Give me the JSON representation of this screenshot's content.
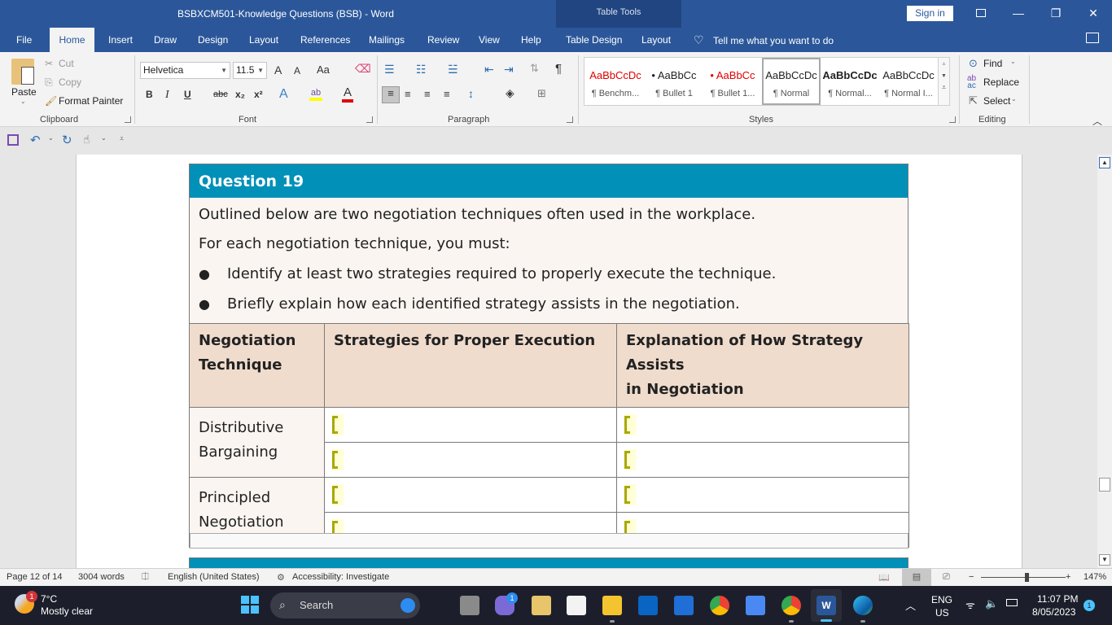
{
  "window": {
    "title": "BSBXCM501-Knowledge Questions (BSB)  -  Word",
    "context_tab_group": "Table Tools",
    "sign_in": "Sign in",
    "controls": [
      "ribbon-display-options",
      "minimize",
      "restore",
      "close"
    ]
  },
  "ribbon": {
    "tabs": [
      {
        "label": "File",
        "active": false
      },
      {
        "label": "Home",
        "active": true
      },
      {
        "label": "Insert",
        "active": false
      },
      {
        "label": "Draw",
        "active": false
      },
      {
        "label": "Design",
        "active": false
      },
      {
        "label": "Layout",
        "active": false
      },
      {
        "label": "References",
        "active": false
      },
      {
        "label": "Mailings",
        "active": false
      },
      {
        "label": "Review",
        "active": false
      },
      {
        "label": "View",
        "active": false
      },
      {
        "label": "Help",
        "active": false
      },
      {
        "label": "Table Design",
        "active": false
      },
      {
        "label": "Layout",
        "active": false
      }
    ],
    "tell_me": "Tell me what you want to do",
    "clipboard": {
      "label": "Clipboard",
      "paste": "Paste",
      "cut": "Cut",
      "copy": "Copy",
      "format_painter": "Format Painter"
    },
    "font": {
      "label": "Font",
      "font_name": "Helvetica",
      "font_size": "11.5",
      "grow": "A",
      "shrink": "A",
      "change_case": "Aa",
      "bold": "B",
      "italic": "I",
      "underline": "U",
      "strikethrough": "abc",
      "subscript": "x₂",
      "superscript": "x²",
      "highlight_color": "#ffff00",
      "font_color": "#e00000"
    },
    "paragraph": {
      "label": "Paragraph",
      "show_marks": "¶"
    },
    "styles": {
      "label": "Styles",
      "items": [
        {
          "sample": "AaBbCcDc",
          "name": "¶ Benchm...",
          "color": "#e00000",
          "selected": false
        },
        {
          "sample": "• AaBbCc",
          "name": "¶ Bullet 1",
          "color": "#222222",
          "selected": false
        },
        {
          "sample": "• AaBbCc",
          "name": "¶ Bullet 1...",
          "color": "#e00000",
          "selected": false
        },
        {
          "sample": "AaBbCcDc",
          "name": "¶ Normal",
          "color": "#222222",
          "selected": true
        },
        {
          "sample": "AaBbCcDc",
          "name": "¶ Normal...",
          "color": "#222222",
          "selected": false,
          "bold": true
        },
        {
          "sample": "AaBbCcDc",
          "name": "¶ Normal I...",
          "color": "#222222",
          "selected": false
        }
      ]
    },
    "editing": {
      "label": "Editing",
      "find": "Find",
      "replace": "Replace",
      "select": "Select"
    }
  },
  "document": {
    "question_title": "Question 19",
    "intro": "Outlined below are two negotiation techniques often used in the workplace.",
    "instruction": "For each negotiation technique, you must:",
    "bullets": [
      "Identify at least two strategies required to properly execute the technique.",
      "Briefly explain how each identified strategy assists in the negotiation."
    ],
    "table": {
      "headers": [
        "Negotiation Technique",
        "Strategies for Proper Execution",
        "Explanation of How Strategy Assists in Negotiation"
      ],
      "header_lines": [
        [
          "Negotiation",
          "Technique"
        ],
        [
          "Strategies for Proper Execution"
        ],
        [
          "Explanation of How Strategy Assists",
          "in Negotiation"
        ]
      ],
      "rows": [
        {
          "technique_lines": [
            "Distributive",
            "Bargaining"
          ],
          "answers": [
            [
              "",
              ""
            ],
            [
              "",
              ""
            ]
          ]
        },
        {
          "technique_lines": [
            "Principled",
            "Negotiation"
          ],
          "answers": [
            [
              "",
              ""
            ],
            [
              "",
              ""
            ]
          ]
        }
      ]
    },
    "header_color": "#0090b8",
    "table_header_color": "#f0dccd"
  },
  "statusbar": {
    "page": "Page 12 of 14",
    "words": "3004 words",
    "language": "English (United States)",
    "accessibility": "Accessibility: Investigate",
    "zoom_minus": "−",
    "zoom_plus": "+",
    "zoom_level": "147%",
    "zoom_percent": 147
  },
  "taskbar": {
    "weather_temp": "7°C",
    "weather_desc": "Mostly clear",
    "weather_badge": "1",
    "search_placeholder": "Search",
    "teams_badge": "1",
    "lang_top": "ENG",
    "lang_bottom": "US",
    "time": "11:07 PM",
    "date": "8/05/2023",
    "notification_badge": "1",
    "apps": [
      "start",
      "search",
      "task-view",
      "teams-chat",
      "onedrive-folder",
      "microsoft-store",
      "file-explorer",
      "outlook",
      "scanner",
      "chrome",
      "google-docs",
      "chrome",
      "word",
      "edge"
    ]
  }
}
